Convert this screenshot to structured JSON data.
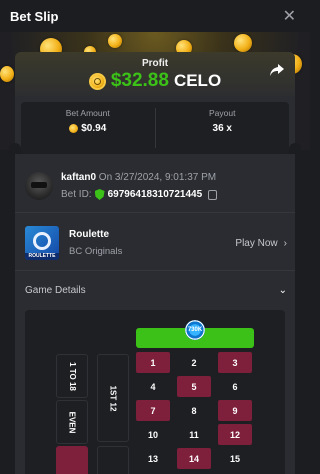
{
  "header": {
    "title": "Bet Slip",
    "close_icon": "close-icon"
  },
  "profit": {
    "label": "Profit",
    "amount": "$32.88",
    "currency": "CELO",
    "amount_color": "#3bc117"
  },
  "stats": {
    "bet_amount_label": "Bet Amount",
    "bet_amount_value": "$0.94",
    "payout_label": "Payout",
    "payout_value": "36 x"
  },
  "user": {
    "name": "kaftan0",
    "date": "On 3/27/2024, 9:01:37 PM",
    "bet_id_label": "Bet ID:",
    "bet_id": "69796418310721445"
  },
  "game": {
    "name": "Roulette",
    "provider": "BC Originals",
    "play_label": "Play Now",
    "thumb_tag": "ROULETTE"
  },
  "details": {
    "label": "Game Details"
  },
  "board": {
    "chip_label": "730K",
    "sides": [
      "1 TO 18",
      "EVEN",
      "1ST 12"
    ],
    "rows": [
      [
        {
          "n": "1",
          "c": "red"
        },
        {
          "n": "2",
          "c": "black"
        },
        {
          "n": "3",
          "c": "red"
        }
      ],
      [
        {
          "n": "4",
          "c": "black"
        },
        {
          "n": "5",
          "c": "red"
        },
        {
          "n": "6",
          "c": "black"
        }
      ],
      [
        {
          "n": "7",
          "c": "red"
        },
        {
          "n": "8",
          "c": "black"
        },
        {
          "n": "9",
          "c": "red"
        }
      ],
      [
        {
          "n": "10",
          "c": "black"
        },
        {
          "n": "11",
          "c": "black"
        },
        {
          "n": "12",
          "c": "red"
        }
      ],
      [
        {
          "n": "13",
          "c": "black"
        },
        {
          "n": "14",
          "c": "red"
        },
        {
          "n": "15",
          "c": "black"
        }
      ]
    ]
  }
}
